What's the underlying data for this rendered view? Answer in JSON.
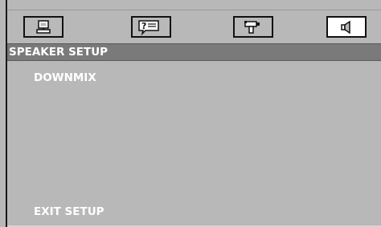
{
  "toolbar": {
    "icons": [
      {
        "name": "general-setup-icon",
        "active": false
      },
      {
        "name": "language-setup-icon",
        "active": false
      },
      {
        "name": "video-setup-icon",
        "active": false
      },
      {
        "name": "speaker-setup-icon",
        "active": true
      }
    ]
  },
  "title": {
    "text": "SPEAKER SETUP"
  },
  "menu": {
    "items": [
      {
        "label": "DOWNMIX"
      },
      {
        "label": "EXIT SETUP"
      }
    ]
  },
  "colors": {
    "background": "#b8b8b8",
    "titlebar": "#7a7a7a",
    "text": "#ffffff",
    "active_icon_bg": "#ffffff"
  }
}
